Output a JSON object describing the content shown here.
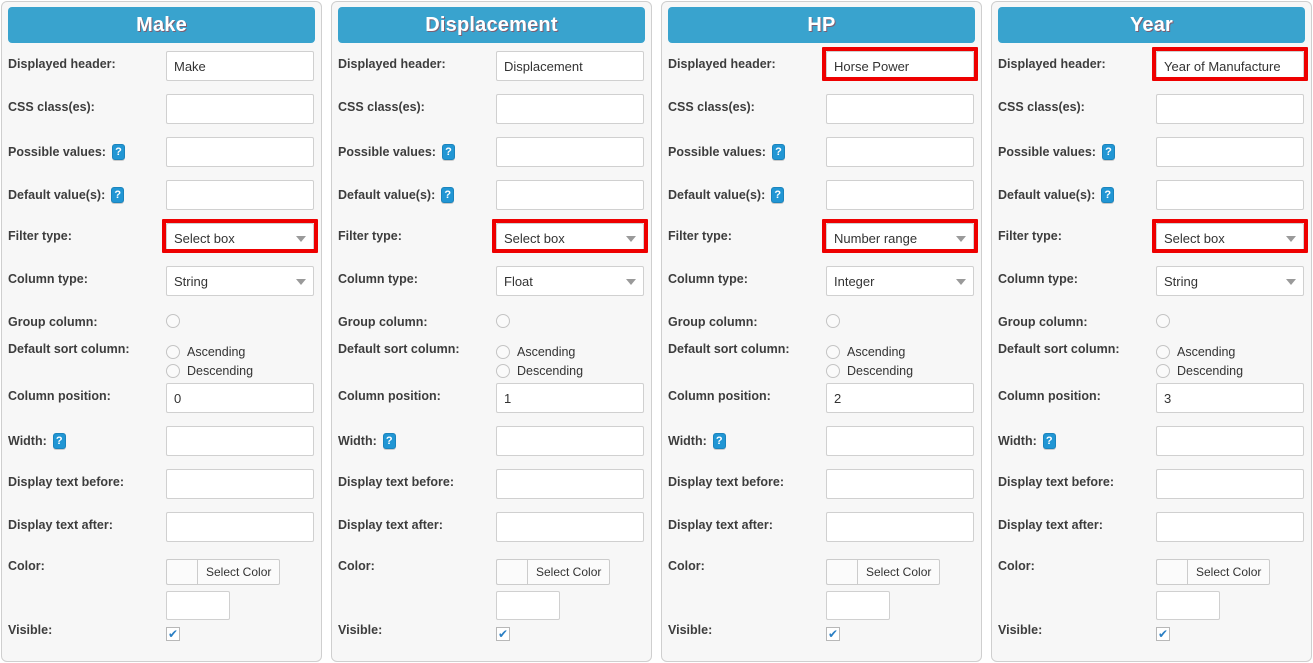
{
  "labels": {
    "displayed_header": "Displayed header:",
    "css_classes": "CSS class(es):",
    "possible_values": "Possible values:",
    "default_values": "Default value(s):",
    "filter_type": "Filter type:",
    "column_type": "Column type:",
    "group_column": "Group column:",
    "default_sort_column": "Default sort column:",
    "column_position": "Column position:",
    "width": "Width:",
    "display_text_before": "Display text before:",
    "display_text_after": "Display text after:",
    "color": "Color:",
    "visible": "Visible:",
    "ascending": "Ascending",
    "descending": "Descending",
    "select_color": "Select Color",
    "help_glyph": "?",
    "check_glyph": "✔"
  },
  "colors": {
    "header_blue": "#39a3ce",
    "highlight_red": "#ee0000",
    "panel_bg": "#f7f7f7",
    "check_blue": "#2a7fc4"
  },
  "panels": [
    {
      "title": "Make",
      "displayed_header": "Make",
      "css_classes": "",
      "possible_values": "",
      "default_values": "",
      "filter_type": "Select box",
      "column_type": "String",
      "column_position": "0",
      "width": "",
      "display_text_before": "",
      "display_text_after": "",
      "color_value": "",
      "visible": true,
      "highlight_header": false,
      "highlight_filter": true
    },
    {
      "title": "Displacement",
      "displayed_header": "Displacement",
      "css_classes": "",
      "possible_values": "",
      "default_values": "",
      "filter_type": "Select box",
      "column_type": "Float",
      "column_position": "1",
      "width": "",
      "display_text_before": "",
      "display_text_after": "",
      "color_value": "",
      "visible": true,
      "highlight_header": false,
      "highlight_filter": true
    },
    {
      "title": "HP",
      "displayed_header": "Horse Power",
      "css_classes": "",
      "possible_values": "",
      "default_values": "",
      "filter_type": "Number range",
      "column_type": "Integer",
      "column_position": "2",
      "width": "",
      "display_text_before": "",
      "display_text_after": "",
      "color_value": "",
      "visible": true,
      "highlight_header": true,
      "highlight_filter": true
    },
    {
      "title": "Year",
      "displayed_header": "Year of Manufacture",
      "css_classes": "",
      "possible_values": "",
      "default_values": "",
      "filter_type": "Select box",
      "column_type": "String",
      "column_position": "3",
      "width": "",
      "display_text_before": "",
      "display_text_after": "",
      "color_value": "",
      "visible": true,
      "highlight_header": true,
      "highlight_filter": true
    }
  ]
}
